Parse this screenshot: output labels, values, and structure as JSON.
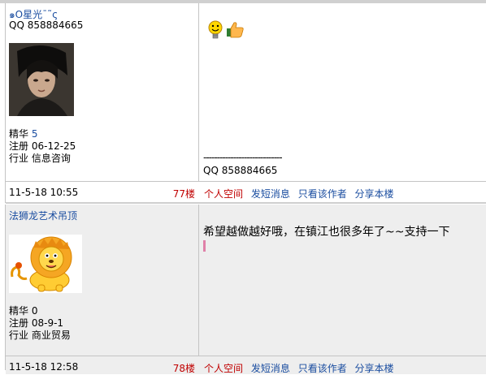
{
  "posts": [
    {
      "user": "๑O星光ˉ˜ς",
      "qq": "QQ 858884665",
      "stats": {
        "jinghua_label": "精华",
        "jinghua": "5",
        "zhuce_label": "注册",
        "zhuce": "06-12-25",
        "hangye_label": "行业",
        "hangye": "信息咨询"
      },
      "time": "11-5-18 10:55",
      "floor": "77楼",
      "actions": [
        "个人空间",
        "发短消息",
        "只看该作者",
        "分享本楼"
      ],
      "sig_line": "-----------------------------",
      "sig_qq": "QQ 858884665",
      "emotes": [
        "lightbulb-emoji-icon",
        "thumbs-up-icon"
      ]
    },
    {
      "user": "法狮龙艺术吊顶",
      "stats": {
        "jinghua_label": "精华",
        "jinghua": "0",
        "zhuce_label": "注册",
        "zhuce": "08-9-1",
        "hangye_label": "行业",
        "hangye": "商业贸易"
      },
      "time": "11-5-18 12:58",
      "floor": "78楼",
      "actions": [
        "个人空间",
        "发短消息",
        "只看该作者",
        "分享本楼"
      ],
      "message": "希望越做越好哦，在镇江也很多年了~~支持一下"
    }
  ],
  "colors": {
    "link": "#1a4da0",
    "accent": "#c00000",
    "border": "#c4c4c4",
    "alt_bg": "#eeeeee"
  }
}
